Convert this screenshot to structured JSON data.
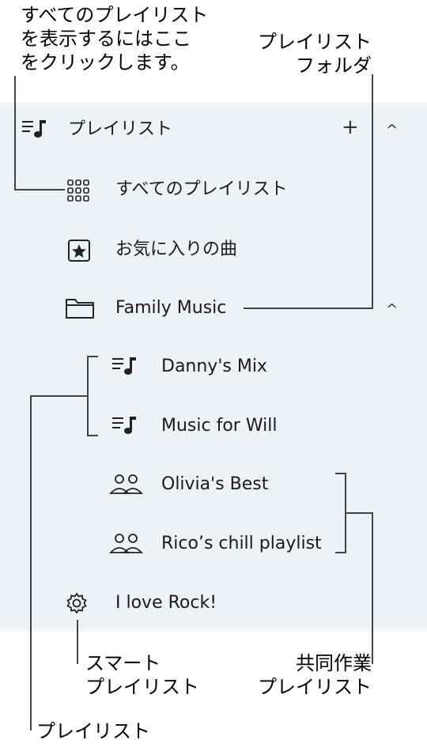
{
  "callouts": {
    "all_playlists": "すべてのプレイリスト\nを表示するにはここ\nをクリックします。",
    "folder": "プレイリスト\nフォルダ",
    "smart": "スマート\nプレイリスト",
    "collab": "共同作業\nプレイリスト",
    "playlist": "プレイリスト"
  },
  "sidebar": {
    "header_label": "プレイリスト",
    "add_symbol": "+",
    "collapse_symbol": "^",
    "items": [
      {
        "label": "すべてのプレイリスト",
        "icon": "grid-icon"
      },
      {
        "label": "お気に入りの曲",
        "icon": "star-box-icon"
      },
      {
        "label": "Family Music",
        "icon": "folder-icon"
      },
      {
        "label": "Danny's Mix",
        "icon": "playlist-icon"
      },
      {
        "label": "Music for Will",
        "icon": "playlist-icon"
      },
      {
        "label": "Olivia's Best",
        "icon": "people-icon"
      },
      {
        "label": "Rico’s chill playlist",
        "icon": "people-icon"
      },
      {
        "label": "I love Rock!",
        "icon": "gear-icon"
      }
    ],
    "folder_collapse_symbol": "^"
  }
}
